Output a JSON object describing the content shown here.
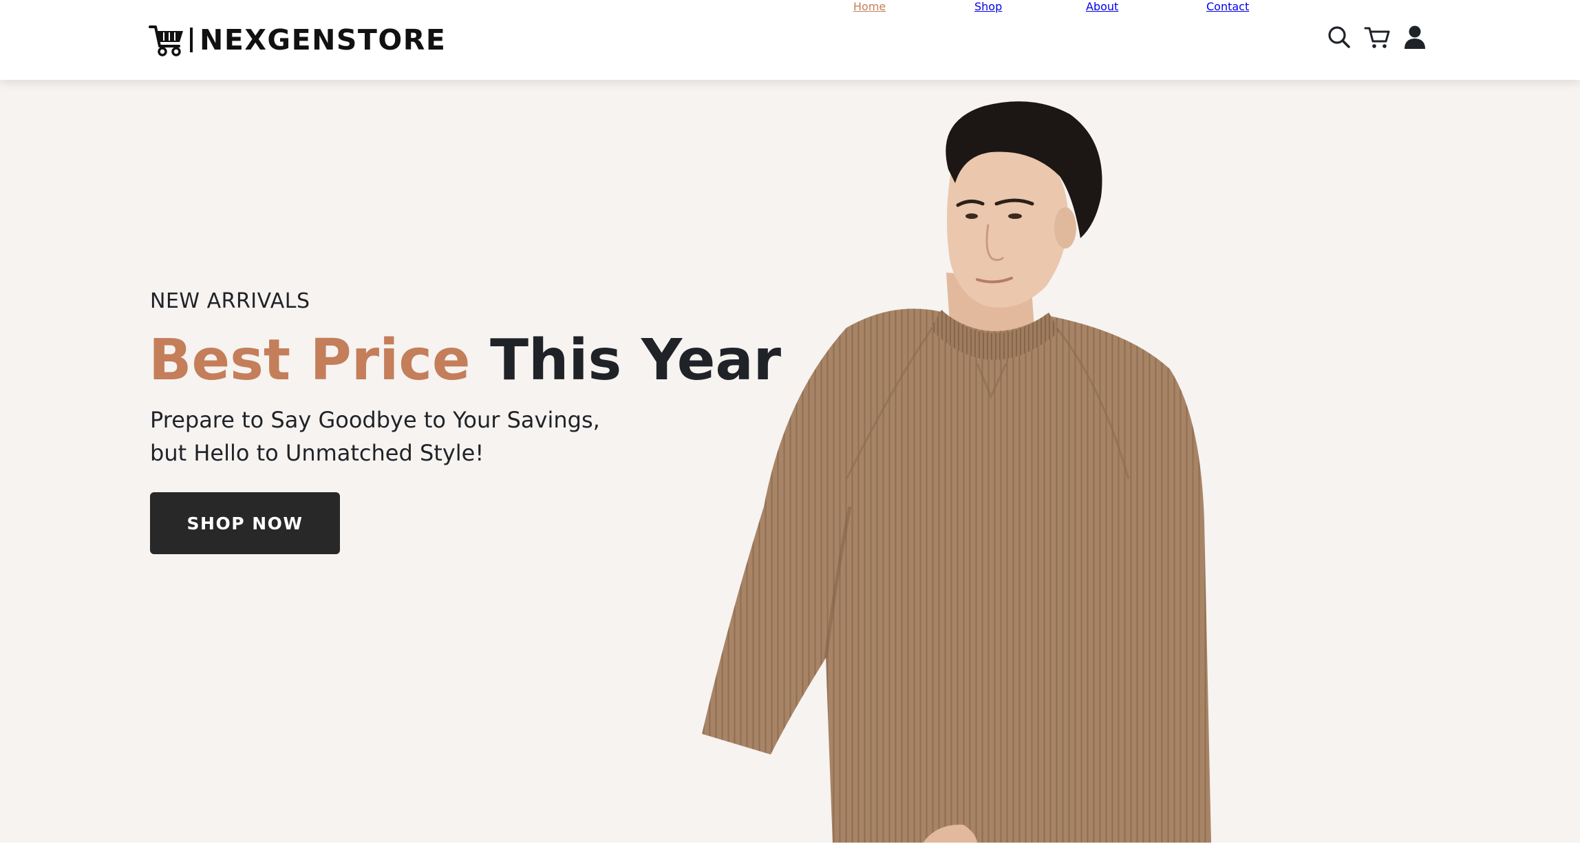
{
  "brand": {
    "name": "NEXGENSTORE",
    "logo_icon": "shopping-cart-icon"
  },
  "nav": {
    "items": [
      {
        "label": "Home",
        "active": true
      },
      {
        "label": "Shop",
        "active": false
      },
      {
        "label": "About",
        "active": false
      },
      {
        "label": "Contact",
        "active": false
      }
    ],
    "icons": [
      "search-icon",
      "cart-icon",
      "user-icon"
    ]
  },
  "hero": {
    "eyebrow": "NEW ARRIVALS",
    "headline_accent": "Best Price",
    "headline_rest": "This Year",
    "subline_1": "Prepare to Say Goodbye to Your Savings,",
    "subline_2": "but Hello to Unmatched Style!",
    "cta_label": "SHOP NOW",
    "image": "model-in-knit-sweater"
  },
  "colors": {
    "accent": "#c47e5a",
    "text": "#1f2328",
    "hero_bg": "#f6f3f1",
    "button_bg": "#282828",
    "button_text": "#ffffff"
  }
}
